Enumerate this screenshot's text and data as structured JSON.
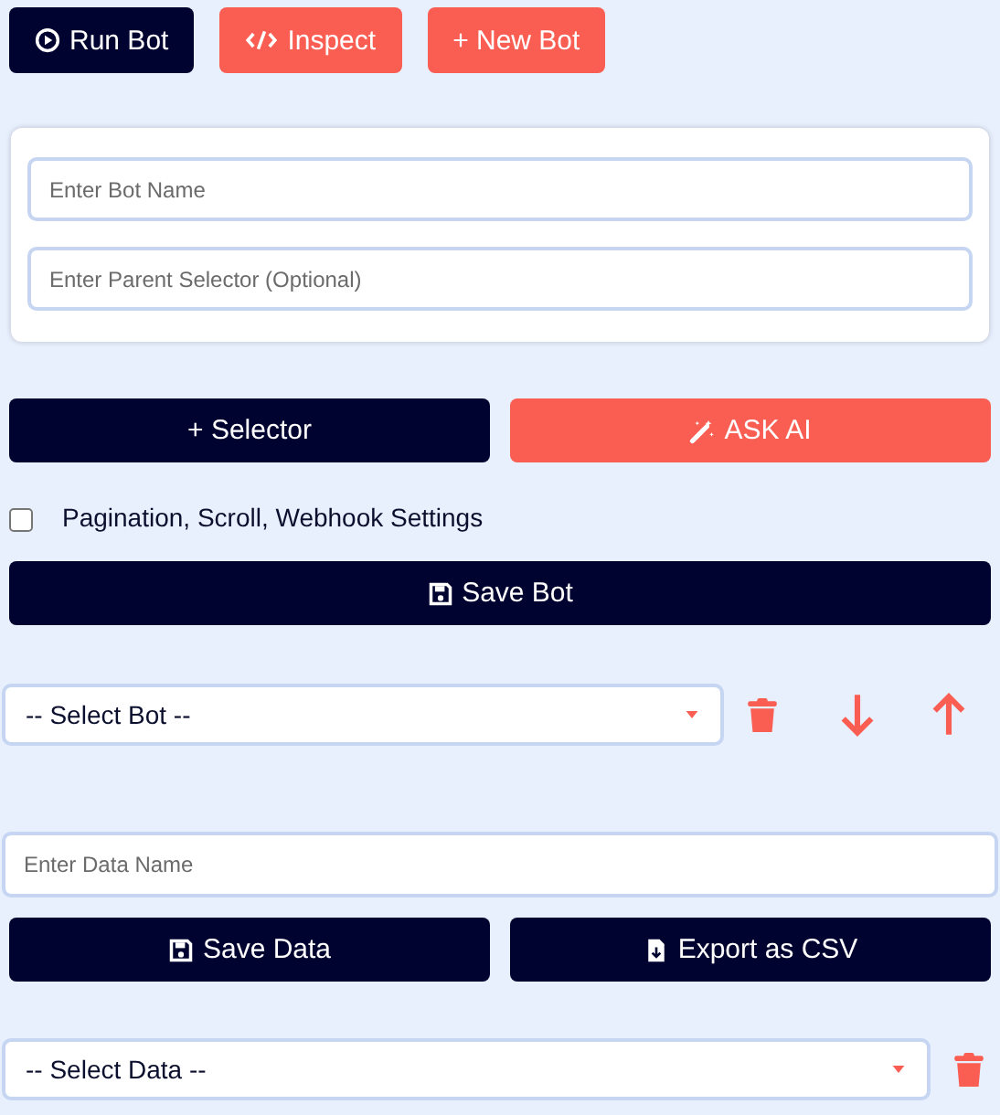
{
  "toolbar": [
    {
      "label": "Run Bot"
    },
    {
      "label": "Inspect"
    },
    {
      "label": "+ New Bot"
    }
  ],
  "bot_form": {
    "name_placeholder": "Enter Bot Name",
    "parent_placeholder": "Enter Parent Selector (Optional)"
  },
  "action_buttons": [
    {
      "label": "+ Selector"
    },
    {
      "label": "ASK AI"
    }
  ],
  "settings_checkbox": {
    "label": "Pagination, Scroll, Webhook Settings",
    "checked": false
  },
  "save_bot_button": {
    "label": "Save Bot"
  },
  "bot_select": {
    "value": "-- Select Bot --"
  },
  "data_name": {
    "placeholder": "Enter Data Name"
  },
  "data_buttons": [
    {
      "label": "Save Data"
    },
    {
      "label": "Export as CSV"
    }
  ],
  "data_select": {
    "value": "-- Select Data --"
  }
}
